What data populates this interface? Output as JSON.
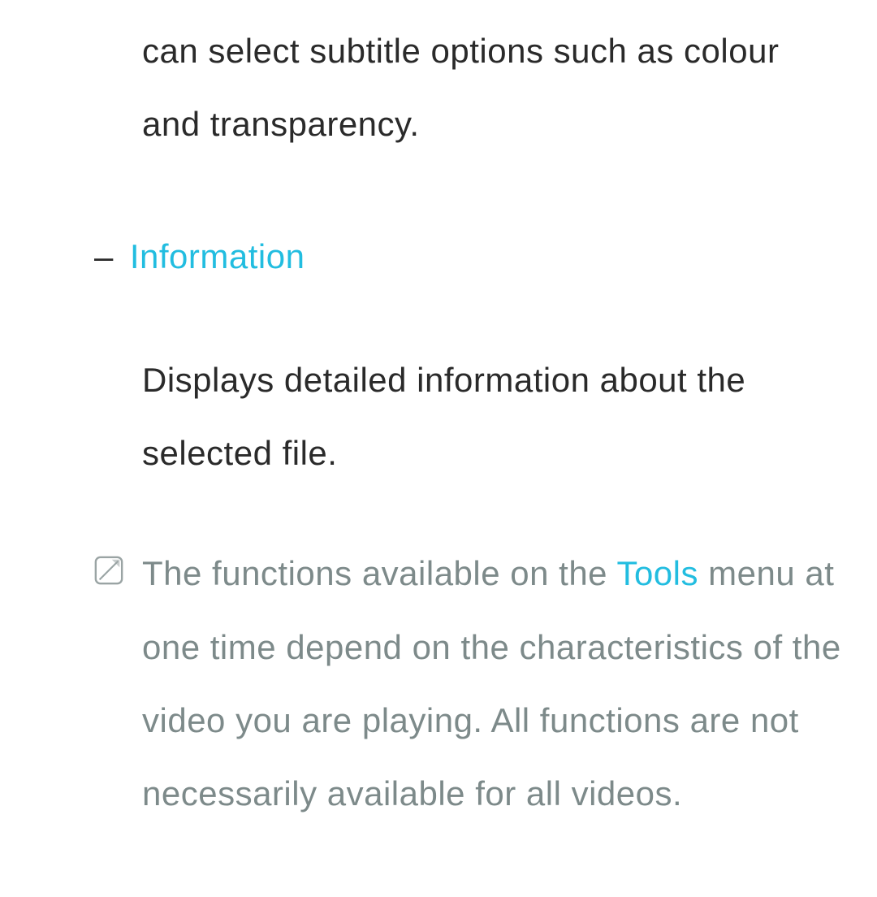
{
  "first_fragment": "can select subtitle options such as colour and transparency.",
  "bullet": {
    "dash": "–",
    "heading": "Information",
    "body": "Displays detailed information about the selected file."
  },
  "note": {
    "pre": "The functions available on the ",
    "highlight": "Tools",
    "post": " menu at one time depend on the characteristics of the video you are playing. All functions are not necessarily available for all videos."
  }
}
